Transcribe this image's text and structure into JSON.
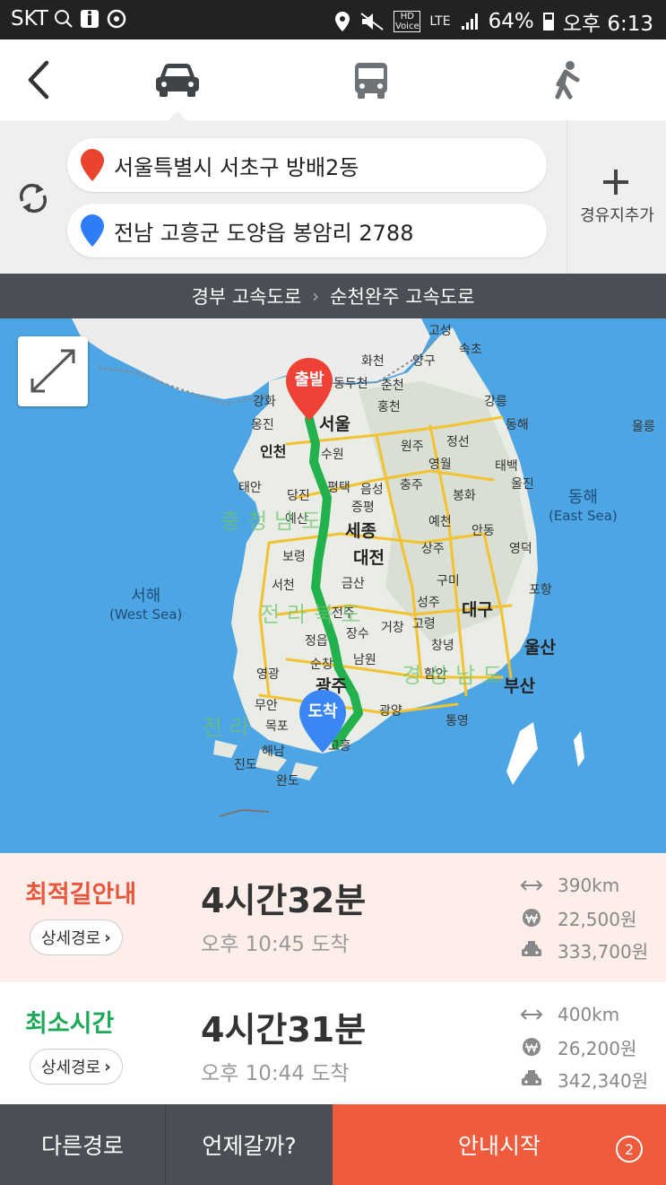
{
  "status_bar": {
    "carrier": "SKT",
    "left_icons": "search, info, sync",
    "hd_voice": "HD Voice",
    "network": "LTE",
    "battery": "64%",
    "battery_level": 0.64,
    "time": "오후 6:13"
  },
  "nav": {
    "back_icon": "chevron-left-icon",
    "modes": [
      {
        "name": "car-icon",
        "selected": true
      },
      {
        "name": "bus-icon",
        "selected": false
      },
      {
        "name": "walk-icon",
        "selected": false
      }
    ]
  },
  "route": {
    "origin": "서울특별시 서초구 방배2동",
    "destination": "전남 고흥군 도양읍 봉암리 2788",
    "waypoint_label": "경유지추가",
    "origin_color": "#e8442e",
    "destination_color": "#2e7cf6"
  },
  "route_bar": {
    "segments": [
      "경부 고속도로",
      "순천완주 고속도로"
    ]
  },
  "map": {
    "start_marker": "출발",
    "end_marker": "도착",
    "route_color": "#22b14c",
    "labels": {
      "gosung": "고성",
      "sokcho": "속초",
      "hwacheon": "화천",
      "yanggu": "양구",
      "dongducheon": "동두천",
      "chuncheon": "춘천",
      "ganghwa": "강화",
      "hongcheon": "홍천",
      "gangneung": "강릉",
      "ongjin": "옹진",
      "seoul": "서울",
      "donghae": "동해",
      "ulleung": "울릉",
      "incheon": "인천",
      "suwon": "수원",
      "wonju": "원주",
      "jeongseon": "정선",
      "yeongwol": "영월",
      "taebaek": "태백",
      "pyeongtaek": "평택",
      "eumseong": "음성",
      "uljin": "울진",
      "dangjin": "당진",
      "jeungpyeong": "증평",
      "chungju": "충주",
      "bonghwa": "봉화",
      "taean": "태안",
      "yesan": "예산",
      "yecheon": "예천",
      "andong": "안동",
      "east_sea": "동해",
      "east_sea_en": "(East Sea)",
      "sejong": "세종",
      "boryeong": "보령",
      "daejeon": "대전",
      "sangju": "상주",
      "yeongdeok": "영덕",
      "seocheon": "서천",
      "geumsan": "금산",
      "gumi": "구미",
      "pohang": "포항",
      "west_sea": "서해",
      "west_sea_en": "(West Sea)",
      "jeonju": "전주",
      "seongju": "성주",
      "daegu": "대구",
      "geochang": "거창",
      "goryeong": "고령",
      "jeongeup": "정읍",
      "jangsu": "장수",
      "changnyeong": "창녕",
      "ulsan": "울산",
      "yeonggwang": "영광",
      "namwon": "남원",
      "sunchang": "순창",
      "gwangju": "광주",
      "haman": "함안",
      "busan": "부산",
      "muan": "무안",
      "gwangyang": "광양",
      "mokpo": "목포",
      "tongyeong": "통영",
      "haenam": "해남",
      "goheung": "고흥",
      "jindo": "진도",
      "wando": "완도",
      "region_chungnam": "충청남도",
      "region_jeonbuk": "전라북도",
      "region_gyeongnam": "경상남도",
      "region_jeonnam": "전라"
    },
    "expand_icon": "expand-icon"
  },
  "options": [
    {
      "name": "최적길안내",
      "detail": "상세경로",
      "duration": "4시간32분",
      "arrival": "오후 10:45 도착",
      "distance": "390km",
      "toll": "22,500원",
      "taxi": "333,700원",
      "color": "#e8563c"
    },
    {
      "name": "최소시간",
      "detail": "상세경로",
      "duration": "4시간31분",
      "arrival": "오후 10:44 도착",
      "distance": "400km",
      "toll": "26,200원",
      "taxi": "342,340원",
      "color": "#1fa85a"
    }
  ],
  "bottom": {
    "other": "다른경로",
    "when": "언제갈까?",
    "start": "안내시작",
    "badge": "2"
  }
}
